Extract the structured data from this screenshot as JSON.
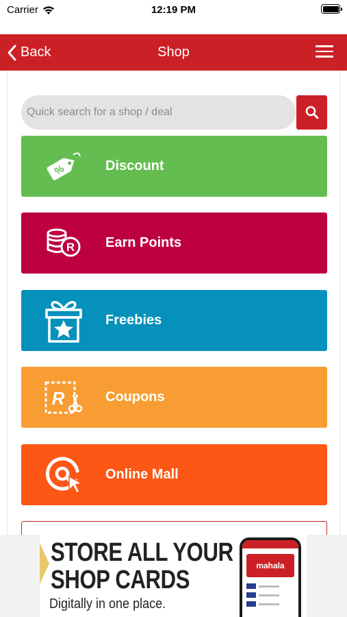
{
  "status_bar": {
    "carrier": "Carrier",
    "time": "12:19 PM",
    "battery_level": 1.0
  },
  "nav": {
    "back_label": "Back",
    "title": "Shop"
  },
  "search": {
    "placeholder": "Quick search for a shop / deal",
    "value": ""
  },
  "categories": [
    {
      "label": "Discount",
      "icon": "discount-tag-icon",
      "color": "#64bd50"
    },
    {
      "label": "Earn Points",
      "icon": "coins-points-icon",
      "color": "#bd0040"
    },
    {
      "label": "Freebies",
      "icon": "gift-star-icon",
      "color": "#0591bb"
    },
    {
      "label": "Coupons",
      "icon": "coupon-scissors-icon",
      "color": "#f89d33"
    },
    {
      "label": "Online Mall",
      "icon": "at-cursor-icon",
      "color": "#fd5716"
    }
  ],
  "ad": {
    "headline_line1": "STORE ALL YOUR",
    "headline_line2": "SHOP CARDS",
    "subline": "Digitally in one place.",
    "phone_brand": "mahala"
  },
  "colors": {
    "brand_red": "#cc2027"
  }
}
